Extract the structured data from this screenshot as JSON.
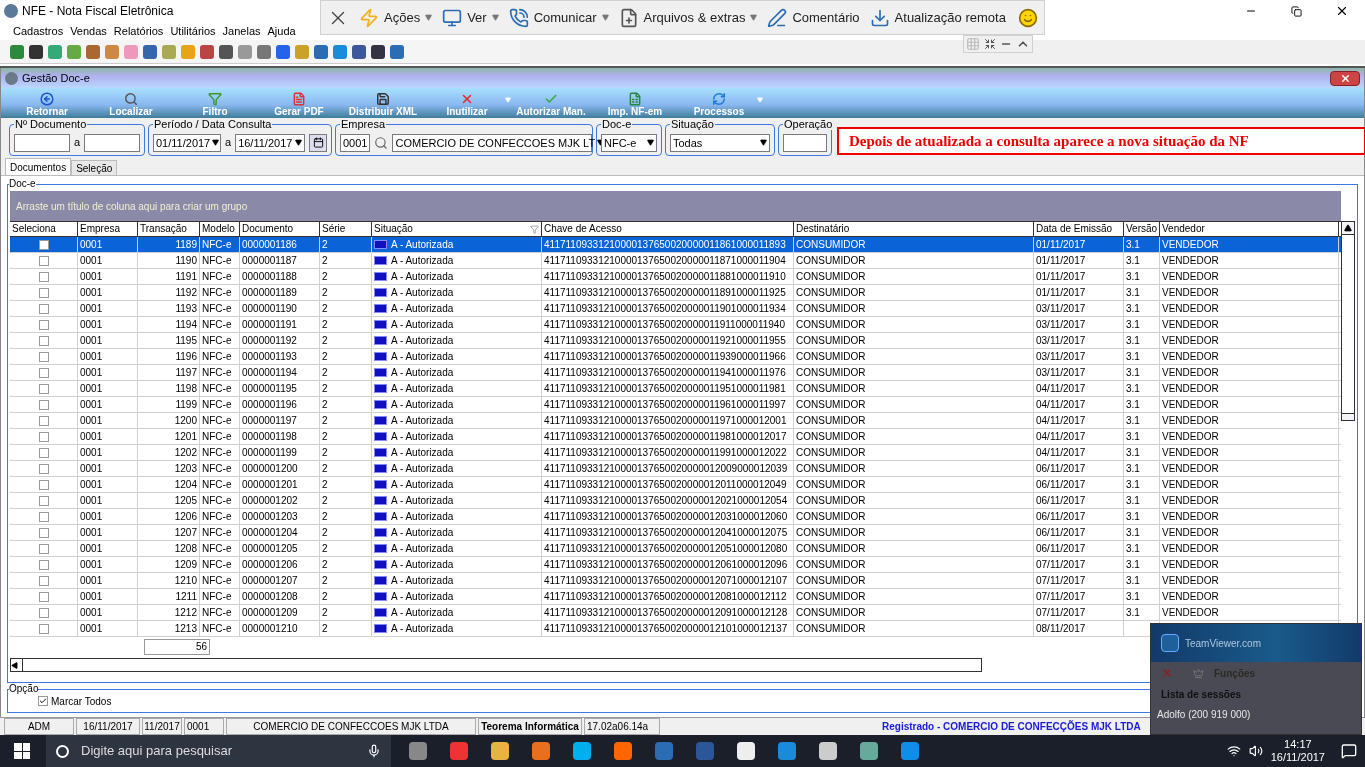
{
  "app_window": {
    "title": "NFE - Nota Fiscal Eletrônica",
    "menu": [
      "Cadastros",
      "Vendas",
      "Relatórios",
      "Utilitários",
      "Janelas",
      "Ajuda"
    ]
  },
  "remote_bar": {
    "items": [
      {
        "label": "Ações",
        "dropdown": true
      },
      {
        "label": "Ver",
        "dropdown": true
      },
      {
        "label": "Comunicar",
        "dropdown": true
      },
      {
        "label": "Arquivos & extras",
        "dropdown": true
      },
      {
        "label": "Comentário",
        "dropdown": false
      },
      {
        "label": "Atualização remota",
        "dropdown": false
      }
    ]
  },
  "doc_window": {
    "title": "Gestão Doc-e",
    "toolbar": [
      {
        "label": "Retornar",
        "dropdown": false
      },
      {
        "label": "Localizar",
        "dropdown": false
      },
      {
        "label": "Filtro",
        "dropdown": false
      },
      {
        "label": "Gerar PDF",
        "dropdown": false
      },
      {
        "label": "Distribuir XML",
        "dropdown": false
      },
      {
        "label": "Inutilizar",
        "dropdown": true
      },
      {
        "label": "Autorizar Man.",
        "dropdown": false
      },
      {
        "label": "Imp. NF-em",
        "dropdown": false
      },
      {
        "label": "Processos",
        "dropdown": true
      }
    ],
    "filters": {
      "numero_documento": {
        "label": "Nº Documento",
        "separator": "a"
      },
      "periodo": {
        "label": "Período / Data Consulta",
        "from": "01/11/2017",
        "separator": "a",
        "to": "16/11/2017"
      },
      "empresa": {
        "label": "Empresa",
        "code": "0001",
        "name": "COMERCIO DE CONFECCOES MJK LT"
      },
      "doc_e": {
        "label": "Doc-e",
        "value": "NFC-e"
      },
      "situacao": {
        "label": "Situação",
        "value": "Todas"
      },
      "operacao": {
        "label": "Operação"
      }
    },
    "annotation": "Depois de atualizada a consulta aparece a nova situação da NF",
    "tabs": [
      {
        "label": "Documentos",
        "selected": true
      },
      {
        "label": "Seleção",
        "selected": false
      }
    ],
    "group_label": "Doc-e",
    "group_hint": "Arraste um título de coluna aqui para criar um grupo",
    "select_column": {
      "label": "Seleciona"
    },
    "columns": [
      {
        "label": "Empresa",
        "kind": "text"
      },
      {
        "label": "Transação",
        "kind": "number"
      },
      {
        "label": "Modelo",
        "kind": "text"
      },
      {
        "label": "Documento",
        "kind": "text"
      },
      {
        "label": "Série",
        "kind": "text"
      },
      {
        "label": "Situação",
        "kind": "status"
      },
      {
        "label": "Chave de Acesso",
        "kind": "text"
      },
      {
        "label": "Destinatário",
        "kind": "text"
      },
      {
        "label": "Data de Emissão",
        "kind": "text"
      },
      {
        "label": "Versão",
        "kind": "text"
      },
      {
        "label": "Vendedor",
        "kind": "text"
      }
    ],
    "rows": [
      {
        "selected": true,
        "checked": false,
        "cells": [
          "0001",
          "1189",
          "NFC-e",
          "0000001186",
          "2",
          "A - Autorizada",
          "41171109331210000137650020000011861000011893",
          "CONSUMIDOR",
          "01/11/2017",
          "3.1",
          "VENDEDOR"
        ]
      },
      {
        "selected": false,
        "checked": false,
        "cells": [
          "0001",
          "1190",
          "NFC-e",
          "0000001187",
          "2",
          "A - Autorizada",
          "41171109331210000137650020000011871000011904",
          "CONSUMIDOR",
          "01/11/2017",
          "3.1",
          "VENDEDOR"
        ]
      },
      {
        "selected": false,
        "checked": false,
        "cells": [
          "0001",
          "1191",
          "NFC-e",
          "0000001188",
          "2",
          "A - Autorizada",
          "41171109331210000137650020000011881000011910",
          "CONSUMIDOR",
          "01/11/2017",
          "3.1",
          "VENDEDOR"
        ]
      },
      {
        "selected": false,
        "checked": false,
        "cells": [
          "0001",
          "1192",
          "NFC-e",
          "0000001189",
          "2",
          "A - Autorizada",
          "41171109331210000137650020000011891000011925",
          "CONSUMIDOR",
          "01/11/2017",
          "3.1",
          "VENDEDOR"
        ]
      },
      {
        "selected": false,
        "checked": false,
        "cells": [
          "0001",
          "1193",
          "NFC-e",
          "0000001190",
          "2",
          "A - Autorizada",
          "41171109331210000137650020000011901000011934",
          "CONSUMIDOR",
          "03/11/2017",
          "3.1",
          "VENDEDOR"
        ]
      },
      {
        "selected": false,
        "checked": false,
        "cells": [
          "0001",
          "1194",
          "NFC-e",
          "0000001191",
          "2",
          "A - Autorizada",
          "41171109331210000137650020000011911000011940",
          "CONSUMIDOR",
          "03/11/2017",
          "3.1",
          "VENDEDOR"
        ]
      },
      {
        "selected": false,
        "checked": false,
        "cells": [
          "0001",
          "1195",
          "NFC-e",
          "0000001192",
          "2",
          "A - Autorizada",
          "41171109331210000137650020000011921000011955",
          "CONSUMIDOR",
          "03/11/2017",
          "3.1",
          "VENDEDOR"
        ]
      },
      {
        "selected": false,
        "checked": false,
        "cells": [
          "0001",
          "1196",
          "NFC-e",
          "0000001193",
          "2",
          "A - Autorizada",
          "41171109331210000137650020000011939000011966",
          "CONSUMIDOR",
          "03/11/2017",
          "3.1",
          "VENDEDOR"
        ]
      },
      {
        "selected": false,
        "checked": false,
        "cells": [
          "0001",
          "1197",
          "NFC-e",
          "0000001194",
          "2",
          "A - Autorizada",
          "41171109331210000137650020000011941000011976",
          "CONSUMIDOR",
          "03/11/2017",
          "3.1",
          "VENDEDOR"
        ]
      },
      {
        "selected": false,
        "checked": false,
        "cells": [
          "0001",
          "1198",
          "NFC-e",
          "0000001195",
          "2",
          "A - Autorizada",
          "41171109331210000137650020000011951000011981",
          "CONSUMIDOR",
          "04/11/2017",
          "3.1",
          "VENDEDOR"
        ]
      },
      {
        "selected": false,
        "checked": false,
        "cells": [
          "0001",
          "1199",
          "NFC-e",
          "0000001196",
          "2",
          "A - Autorizada",
          "41171109331210000137650020000011961000011997",
          "CONSUMIDOR",
          "04/11/2017",
          "3.1",
          "VENDEDOR"
        ]
      },
      {
        "selected": false,
        "checked": false,
        "cells": [
          "0001",
          "1200",
          "NFC-e",
          "0000001197",
          "2",
          "A - Autorizada",
          "41171109331210000137650020000011971000012001",
          "CONSUMIDOR",
          "04/11/2017",
          "3.1",
          "VENDEDOR"
        ]
      },
      {
        "selected": false,
        "checked": false,
        "cells": [
          "0001",
          "1201",
          "NFC-e",
          "0000001198",
          "2",
          "A - Autorizada",
          "41171109331210000137650020000011981000012017",
          "CONSUMIDOR",
          "04/11/2017",
          "3.1",
          "VENDEDOR"
        ]
      },
      {
        "selected": false,
        "checked": false,
        "cells": [
          "0001",
          "1202",
          "NFC-e",
          "0000001199",
          "2",
          "A - Autorizada",
          "41171109331210000137650020000011991000012022",
          "CONSUMIDOR",
          "04/11/2017",
          "3.1",
          "VENDEDOR"
        ]
      },
      {
        "selected": false,
        "checked": false,
        "cells": [
          "0001",
          "1203",
          "NFC-e",
          "0000001200",
          "2",
          "A - Autorizada",
          "41171109331210000137650020000012009000012039",
          "CONSUMIDOR",
          "06/11/2017",
          "3.1",
          "VENDEDOR"
        ]
      },
      {
        "selected": false,
        "checked": false,
        "cells": [
          "0001",
          "1204",
          "NFC-e",
          "0000001201",
          "2",
          "A - Autorizada",
          "41171109331210000137650020000012011000012049",
          "CONSUMIDOR",
          "06/11/2017",
          "3.1",
          "VENDEDOR"
        ]
      },
      {
        "selected": false,
        "checked": false,
        "cells": [
          "0001",
          "1205",
          "NFC-e",
          "0000001202",
          "2",
          "A - Autorizada",
          "41171109331210000137650020000012021000012054",
          "CONSUMIDOR",
          "06/11/2017",
          "3.1",
          "VENDEDOR"
        ]
      },
      {
        "selected": false,
        "checked": false,
        "cells": [
          "0001",
          "1206",
          "NFC-e",
          "0000001203",
          "2",
          "A - Autorizada",
          "41171109331210000137650020000012031000012060",
          "CONSUMIDOR",
          "06/11/2017",
          "3.1",
          "VENDEDOR"
        ]
      },
      {
        "selected": false,
        "checked": false,
        "cells": [
          "0001",
          "1207",
          "NFC-e",
          "0000001204",
          "2",
          "A - Autorizada",
          "41171109331210000137650020000012041000012075",
          "CONSUMIDOR",
          "06/11/2017",
          "3.1",
          "VENDEDOR"
        ]
      },
      {
        "selected": false,
        "checked": false,
        "cells": [
          "0001",
          "1208",
          "NFC-e",
          "0000001205",
          "2",
          "A - Autorizada",
          "41171109331210000137650020000012051000012080",
          "CONSUMIDOR",
          "06/11/2017",
          "3.1",
          "VENDEDOR"
        ]
      },
      {
        "selected": false,
        "checked": false,
        "cells": [
          "0001",
          "1209",
          "NFC-e",
          "0000001206",
          "2",
          "A - Autorizada",
          "41171109331210000137650020000012061000012096",
          "CONSUMIDOR",
          "07/11/2017",
          "3.1",
          "VENDEDOR"
        ]
      },
      {
        "selected": false,
        "checked": false,
        "cells": [
          "0001",
          "1210",
          "NFC-e",
          "0000001207",
          "2",
          "A - Autorizada",
          "41171109331210000137650020000012071000012107",
          "CONSUMIDOR",
          "07/11/2017",
          "3.1",
          "VENDEDOR"
        ]
      },
      {
        "selected": false,
        "checked": false,
        "cells": [
          "0001",
          "1211",
          "NFC-e",
          "0000001208",
          "2",
          "A - Autorizada",
          "41171109331210000137650020000012081000012112",
          "CONSUMIDOR",
          "07/11/2017",
          "3.1",
          "VENDEDOR"
        ]
      },
      {
        "selected": false,
        "checked": false,
        "cells": [
          "0001",
          "1212",
          "NFC-e",
          "0000001209",
          "2",
          "A - Autorizada",
          "41171109331210000137650020000012091000012128",
          "CONSUMIDOR",
          "07/11/2017",
          "3.1",
          "VENDEDOR"
        ]
      },
      {
        "selected": false,
        "checked": false,
        "cells": [
          "0001",
          "1213",
          "NFC-e",
          "0000001210",
          "2",
          "A - Autorizada",
          "41171109331210000137650020000012101000012137",
          "CONSUMIDOR",
          "08/11/2017"
        ]
      }
    ],
    "total": "56",
    "option_label": "Opção",
    "mark_all": {
      "label": "Marcar Todos",
      "checked": true
    }
  },
  "status_bar": {
    "user": "ADM",
    "date": "16/11/2017",
    "period": "11/2017",
    "company_code": "0001",
    "company": "COMERCIO DE CONFECCOES MJK LTDA",
    "vendor": "Teorema Informática",
    "version": "17.02a06.14a",
    "registration": "Registrado - COMERCIO DE CONFECÇÕES MJK LTDA"
  },
  "teamviewer": {
    "brand": "TeamViewer.com",
    "functions": "Funções",
    "sessions_title": "Lista de sessões",
    "session": "Adolfo (200 919 000)"
  },
  "taskbar": {
    "search_placeholder": "Digite aqui para pesquisar",
    "time": "14:17",
    "date": "16/11/2017"
  }
}
